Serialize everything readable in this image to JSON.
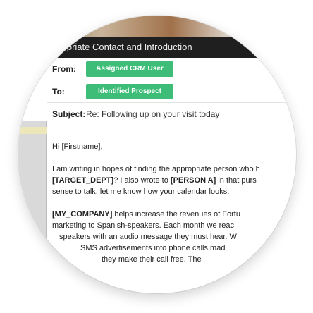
{
  "email": {
    "title": "...priate Contact and Introduction",
    "from_label": "From:",
    "from_value": "Assigned CRM User",
    "to_label": "To:",
    "to_value": "Identified Prospect",
    "subject_label": "Subject:",
    "subject_value": "Re: Following up on your visit today",
    "greeting": "Hi [Firstname],",
    "p1": {
      "l1": "I am writing in hopes of finding the appropriate person who h",
      "l2_b1": "[TARGET_DEPT]",
      "l2_t1": "? I also wrote to ",
      "l2_b2": "[PERSON A]",
      "l2_t2": " in that purs",
      "l3": "sense to talk, let me know how your calendar looks."
    },
    "p2": {
      "b1": "[MY_COMPANY]",
      "t1": " helps increase the revenues of Fortu",
      "l2": "marketing to Spanish-speakers. Each month we reac",
      "l3": "speakers with an audio message they must hear. W",
      "l4": "SMS advertisements into phone calls mad",
      "l5": "they make their call free. The"
    }
  },
  "colors": {
    "accent": "#3dbd78",
    "titlebar": "#1f1f1f"
  }
}
